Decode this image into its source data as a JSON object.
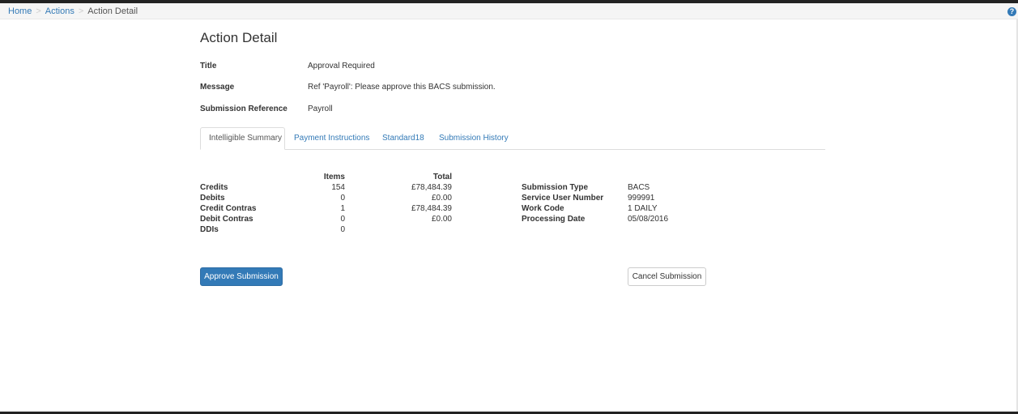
{
  "breadcrumb": {
    "home": "Home",
    "actions": "Actions",
    "current": "Action Detail",
    "separator": ">"
  },
  "help_icon": "?",
  "page_title": "Action Detail",
  "details": {
    "title_label": "Title",
    "title_value": "Approval Required",
    "message_label": "Message",
    "message_value": "Ref 'Payroll': Please approve this BACS submission.",
    "reference_label": "Submission Reference",
    "reference_value": "Payroll"
  },
  "tabs": [
    {
      "label": "Intelligible Summary",
      "active": true
    },
    {
      "label": "Payment Instructions",
      "active": false
    },
    {
      "label": "Standard18",
      "active": false
    },
    {
      "label": "Submission History",
      "active": false
    }
  ],
  "summary": {
    "items_header": "Items",
    "total_header": "Total",
    "rows": [
      {
        "label": "Credits",
        "items": "154",
        "total": "£78,484.39"
      },
      {
        "label": "Debits",
        "items": "0",
        "total": "£0.00"
      },
      {
        "label": "Credit Contras",
        "items": "1",
        "total": "£78,484.39"
      },
      {
        "label": "Debit Contras",
        "items": "0",
        "total": "£0.00"
      },
      {
        "label": "DDIs",
        "items": "0",
        "total": ""
      }
    ],
    "info": [
      {
        "label": "Submission Type",
        "value": "BACS"
      },
      {
        "label": "Service User Number",
        "value": "999991"
      },
      {
        "label": "Work Code",
        "value": "1 DAILY"
      },
      {
        "label": "Processing Date",
        "value": "05/08/2016"
      }
    ]
  },
  "buttons": {
    "approve": "Approve Submission",
    "cancel": "Cancel Submission"
  },
  "colors": {
    "link": "#337ab7",
    "primary_button": "#337ab7",
    "breadcrumb_bg": "#f5f5f5"
  }
}
